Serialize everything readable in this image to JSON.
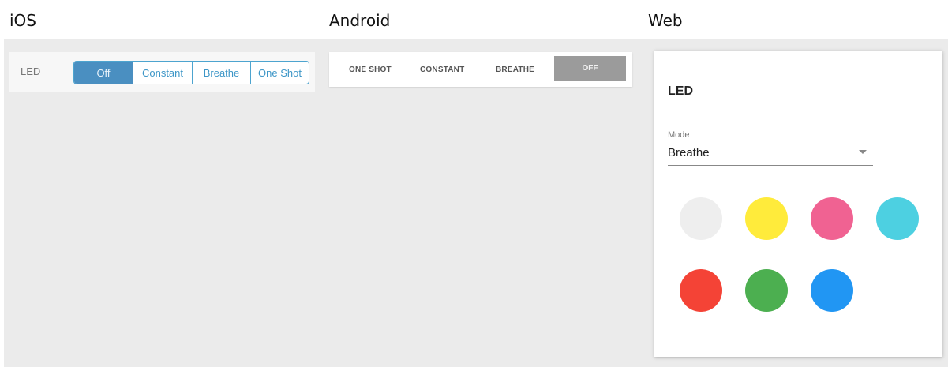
{
  "headings": {
    "ios": "iOS",
    "android": "Android",
    "web": "Web"
  },
  "ios": {
    "label": "LED",
    "segments": [
      "Off",
      "Constant",
      "Breathe",
      "One Shot"
    ],
    "active_index": 0,
    "accent": "#4a8fc1"
  },
  "android": {
    "items": [
      "ONE SHOT",
      "CONSTANT",
      "BREATHE",
      "OFF"
    ],
    "selected_index": 3
  },
  "web": {
    "title": "LED",
    "mode_label": "Mode",
    "mode_value": "Breathe",
    "caret_icon": "caret-down-icon",
    "swatches": [
      {
        "name": "white",
        "color": "#eeeeee"
      },
      {
        "name": "yellow",
        "color": "#ffeb3b"
      },
      {
        "name": "pink",
        "color": "#f06292"
      },
      {
        "name": "cyan",
        "color": "#4dd0e1"
      },
      {
        "name": "red",
        "color": "#f44336"
      },
      {
        "name": "green",
        "color": "#4caf50"
      },
      {
        "name": "blue",
        "color": "#2196f3"
      }
    ]
  }
}
